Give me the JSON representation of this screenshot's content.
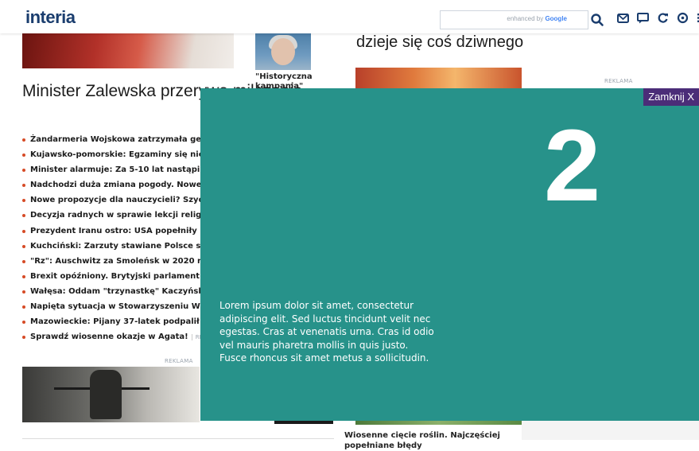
{
  "header": {
    "logo": "interia",
    "search": {
      "placeholder": "",
      "credit_prefix": "enhanced by",
      "credit_brand": "Google"
    }
  },
  "left": {
    "portrait_caption": "\"Historyczna kampania\"",
    "headline": "Minister Zalewska przerywa milczenie",
    "news": [
      "Żandarmeria Wojskowa zatrzymała generała L",
      "Kujawsko-pomorskie: Egzaminy się nie odbędą",
      "Minister alarmuje: Za 5-10 lat nastąpi krach",
      "Nadchodzi duża zmiana pogody. Nowe prognoz",
      "Nowe propozycje dla nauczycieli? Szydło zabra",
      "Decyzja radnych w sprawie lekcji religii. KEP p",
      "Prezydent Iranu ostro: USA popełniły błąd",
      "Kuchciński: Zarzuty stawiane Polsce są bezzas",
      "\"Rz\": Auschwitz za Smoleńsk w 2020 roku?",
      "Brexit opóźniony. Brytyjski parlament zdecyd",
      "Wałęsa: Oddam \"trzynastkę\" Kaczyńskiemu",
      "Napięta sytuacja w Stowarzyszeniu Wiosna. K",
      "Mazowieckie: Pijany 37-latek podpalił łąkę"
    ],
    "promo": {
      "text": "Sprawdź wiosenne okazje w Agata!",
      "tag": "REKLAMA"
    },
    "ad_label": "REKLAMA"
  },
  "right": {
    "title": "dzieje się coś dziwnego",
    "ad_label": "REKLAMA",
    "bottom_caption": "Wiosenne cięcie roślin. Najczęściej popełniane błędy"
  },
  "overlay": {
    "close_label": "Zamknij X",
    "number": "2",
    "text": "Lorem ipsum dolor sit amet, consectetur adipiscing elit. Sed luctus tincidunt velit nec egestas. Cras at venenatis urna. Cras id odio vel mauris pharetra mollis in quis justo. Fusce rhoncus sit amet metus a sollicitudin.",
    "bg_color": "#27928a",
    "close_color": "#4b2d78"
  },
  "icons": [
    "search-icon",
    "mail-icon",
    "chat-icon",
    "refresh-icon",
    "settings-icon",
    "menu-icon"
  ]
}
